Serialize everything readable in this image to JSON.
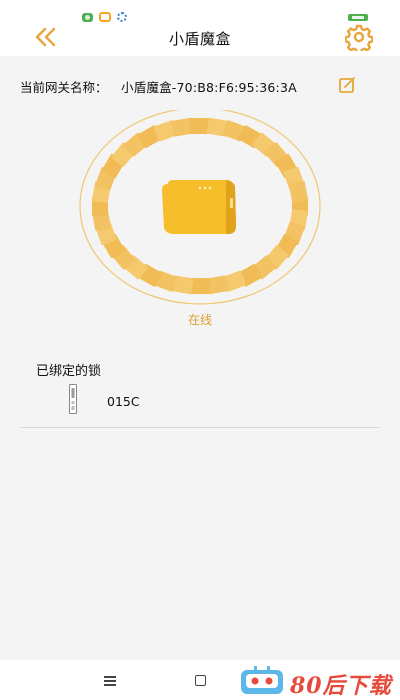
{
  "status_bar": {
    "icons": [
      "app-notification-icon",
      "message-icon",
      "settings-notification-icon"
    ]
  },
  "header": {
    "title": "小盾魔盒",
    "back_icon": "double-chevron-left-icon",
    "settings_icon": "gear-icon"
  },
  "gateway": {
    "label": "当前网关名称：",
    "name": "小盾魔盒-70:B8:F6:95:36:3A",
    "edit_icon": "edit-icon"
  },
  "device": {
    "status": "在线",
    "icon": "gateway-box-icon"
  },
  "locks": {
    "title": "已绑定的锁",
    "items": [
      {
        "name": "015C",
        "icon": "door-lock-icon"
      }
    ]
  },
  "nav": {
    "menu_icon": "menu-icon",
    "home_icon": "home-square-icon"
  },
  "watermark": {
    "text": "80后下载"
  },
  "colors": {
    "accent": "#e8a53a",
    "ring_tile": "#f3c66a",
    "device": "#f7be2b",
    "status_online": "#e0a030",
    "watermark": "#e64a3b"
  }
}
